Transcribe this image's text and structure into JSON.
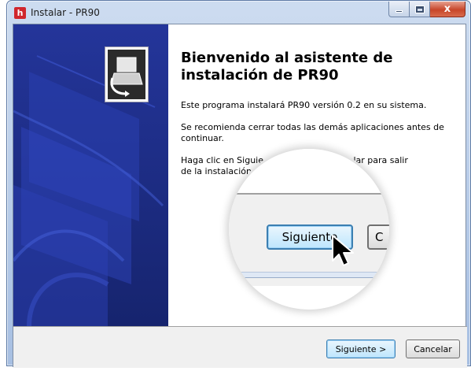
{
  "window": {
    "title": "Instalar - PR90",
    "app_icon": "h",
    "caption": {
      "minimize_icon": "minimize-icon",
      "maximize_icon": "maximize-icon",
      "close_glyph": "x"
    }
  },
  "wizard": {
    "heading": "Bienvenido al asistente de instalación de PR90",
    "para1": "Este programa instalará PR90 versión 0.2 en su sistema.",
    "para2": "Se recomienda cerrar todas las demás aplicaciones antes de continuar.",
    "para3": "Haga clic en Siguiente para continuar o en Cancelar para salir de la instalación.",
    "para3_left": "Haga clic en Siguie",
    "para3_right": "en Cancelar para salir",
    "para3_line2": "de la instalación"
  },
  "footer": {
    "next_label": "Siguiente >",
    "cancel_label": "Cancelar"
  },
  "magnifier": {
    "next_label_zoom": "Siguiente",
    "cancel_label_zoom": "C"
  },
  "colors": {
    "side_panel": "#1c2d88",
    "accent_button": "#3c7fb1",
    "close_button": "#c7462a"
  }
}
